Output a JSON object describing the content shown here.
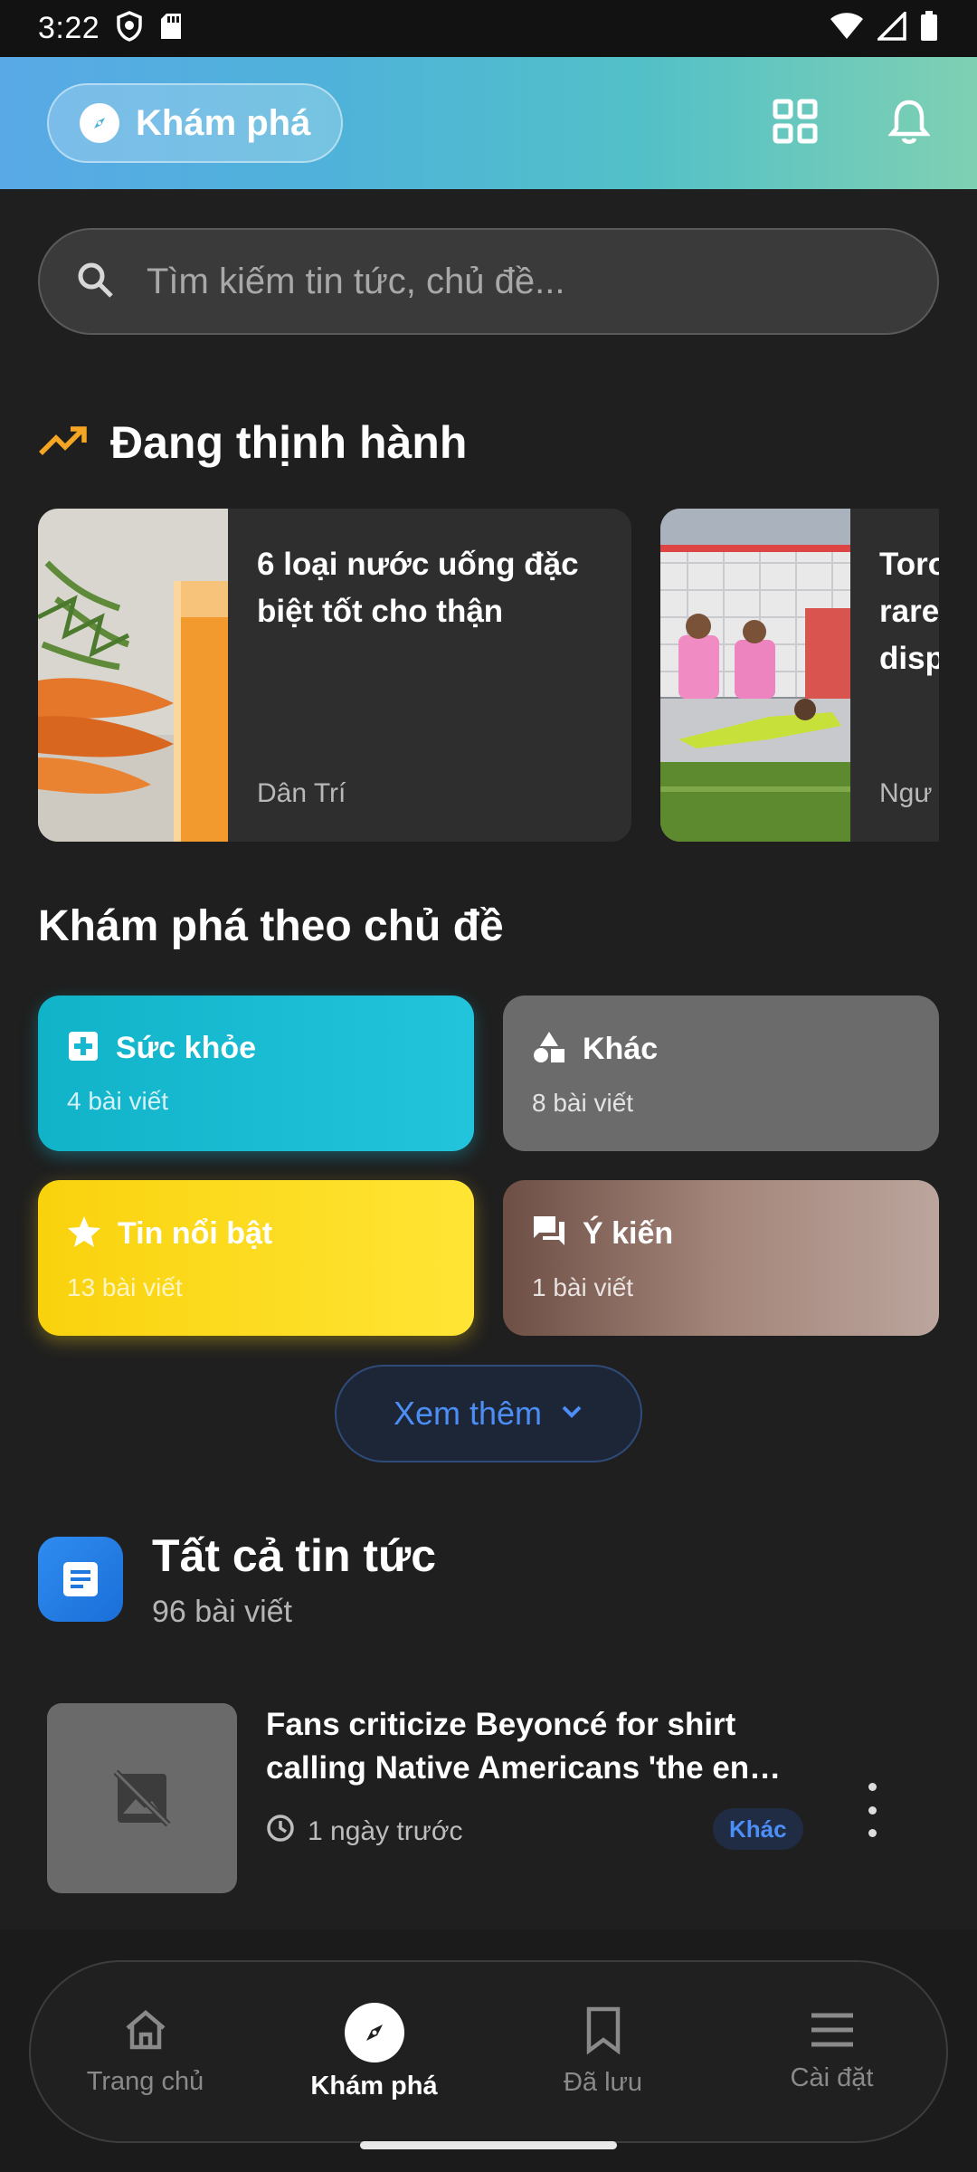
{
  "status_bar": {
    "time": "3:22"
  },
  "header": {
    "explore_label": "Khám phá"
  },
  "search": {
    "placeholder": "Tìm kiếm tin tức, chủ đề..."
  },
  "trending": {
    "title": "Đang thịnh hành",
    "cards": [
      {
        "title": "6 loại nước uống đặc biệt tốt cho thận",
        "source": "Dân Trí"
      },
      {
        "title": "Toro rare disp",
        "source": "Ngư"
      }
    ]
  },
  "topics": {
    "title": "Khám phá theo chủ đề",
    "items": [
      {
        "label": "Sức khỏe",
        "count": "4 bài viết",
        "icon": "medical-plus-icon",
        "color": "#1cbcd4"
      },
      {
        "label": "Khác",
        "count": "8 bài viết",
        "icon": "shapes-icon",
        "color": "#6b6b6b"
      },
      {
        "label": "Tin nổi bật",
        "count": "13 bài viết",
        "icon": "star-icon",
        "color": "#fdd820"
      },
      {
        "label": "Ý kiến",
        "count": "1 bài viết",
        "icon": "forum-icon",
        "color": "#8d6e63"
      }
    ],
    "more_label": "Xem thêm"
  },
  "all_news": {
    "title": "Tất cả tin tức",
    "count": "96 bài viết",
    "items": [
      {
        "title": "Fans criticize Beyoncé for shirt calling Native Americans 'the en…",
        "time": "1 ngày trước",
        "badge": "Khác"
      }
    ]
  },
  "bottom_nav": {
    "items": [
      {
        "label": "Trang chủ",
        "icon": "home-icon",
        "active": false
      },
      {
        "label": "Khám phá",
        "icon": "compass-icon",
        "active": true
      },
      {
        "label": "Đã lưu",
        "icon": "bookmark-icon",
        "active": false
      },
      {
        "label": "Cài đặt",
        "icon": "menu-icon",
        "active": false
      }
    ]
  },
  "colors": {
    "accent": "#4c8df6",
    "trending": "#f5a623",
    "background": "#1f1f1f"
  }
}
